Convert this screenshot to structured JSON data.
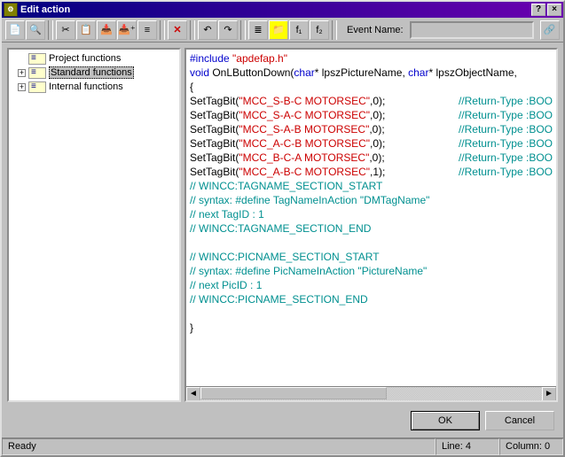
{
  "title": "Edit action",
  "titlebar": {
    "help": "?",
    "close": "×"
  },
  "toolbar": {
    "icons": [
      "new-icon",
      "open-icon",
      "cut-icon",
      "copy-icon",
      "paste-icon",
      "paste-special-icon",
      "stack-icon",
      "delete-icon",
      "undo-icon",
      "redo-icon",
      "fx-icon",
      "folder-icon",
      "fx2-icon",
      "fx3-icon"
    ],
    "event_label": "Event Name:",
    "event_value": "",
    "link_icon": "link-icon"
  },
  "tree": {
    "items": [
      {
        "label": "Project functions",
        "exp": "",
        "sel": false,
        "root": true
      },
      {
        "label": "Standard functions",
        "exp": "+",
        "sel": true
      },
      {
        "label": "Internal functions",
        "exp": "+",
        "sel": false
      }
    ]
  },
  "code": {
    "l1a": "#include",
    "l1b": "\"apdefap.h\"",
    "l2a": "void",
    "l2b": " OnLButtonDown(",
    "l2c": "char",
    "l2d": "* lpszPictureName, ",
    "l2e": "char",
    "l2f": "* lpszObjectName,",
    "l3": "{",
    "calls": [
      {
        "pre": "SetTagBit(",
        "str": "\"MCC_S-B-C MOTORSEC\"",
        "post": ",0);",
        "cmt": "//Return-Type :BOO"
      },
      {
        "pre": "SetTagBit(",
        "str": "\"MCC_S-A-C MOTORSEC\"",
        "post": ",0);",
        "cmt": "//Return-Type :BOO"
      },
      {
        "pre": "SetTagBit(",
        "str": "\"MCC_S-A-B MOTORSEC\"",
        "post": ",0);",
        "cmt": "//Return-Type :BOO"
      },
      {
        "pre": "SetTagBit(",
        "str": "\"MCC_A-C-B MOTORSEC\"",
        "post": ",0);",
        "cmt": "//Return-Type :BOO"
      },
      {
        "pre": "SetTagBit(",
        "str": "\"MCC_B-C-A MOTORSEC\"",
        "post": ",0);",
        "cmt": "//Return-Type :BOO"
      },
      {
        "pre": "SetTagBit(",
        "str": "\"MCC_A-B-C MOTORSEC\"",
        "post": ",1);",
        "cmt": "//Return-Type :BOO"
      }
    ],
    "c1": "// WINCC:TAGNAME_SECTION_START",
    "c2": "// syntax: #define TagNameInAction \"DMTagName\"",
    "c3": "// next TagID : 1",
    "c4": "// WINCC:TAGNAME_SECTION_END",
    "c5": "// WINCC:PICNAME_SECTION_START",
    "c6": "// syntax: #define PicNameInAction \"PictureName\"",
    "c7": "// next PicID : 1",
    "c8": "// WINCC:PICNAME_SECTION_END",
    "l_end": "}"
  },
  "buttons": {
    "ok": "OK",
    "cancel": "Cancel"
  },
  "status": {
    "ready": "Ready",
    "line": "Line: 4",
    "col": "Column: 0"
  }
}
